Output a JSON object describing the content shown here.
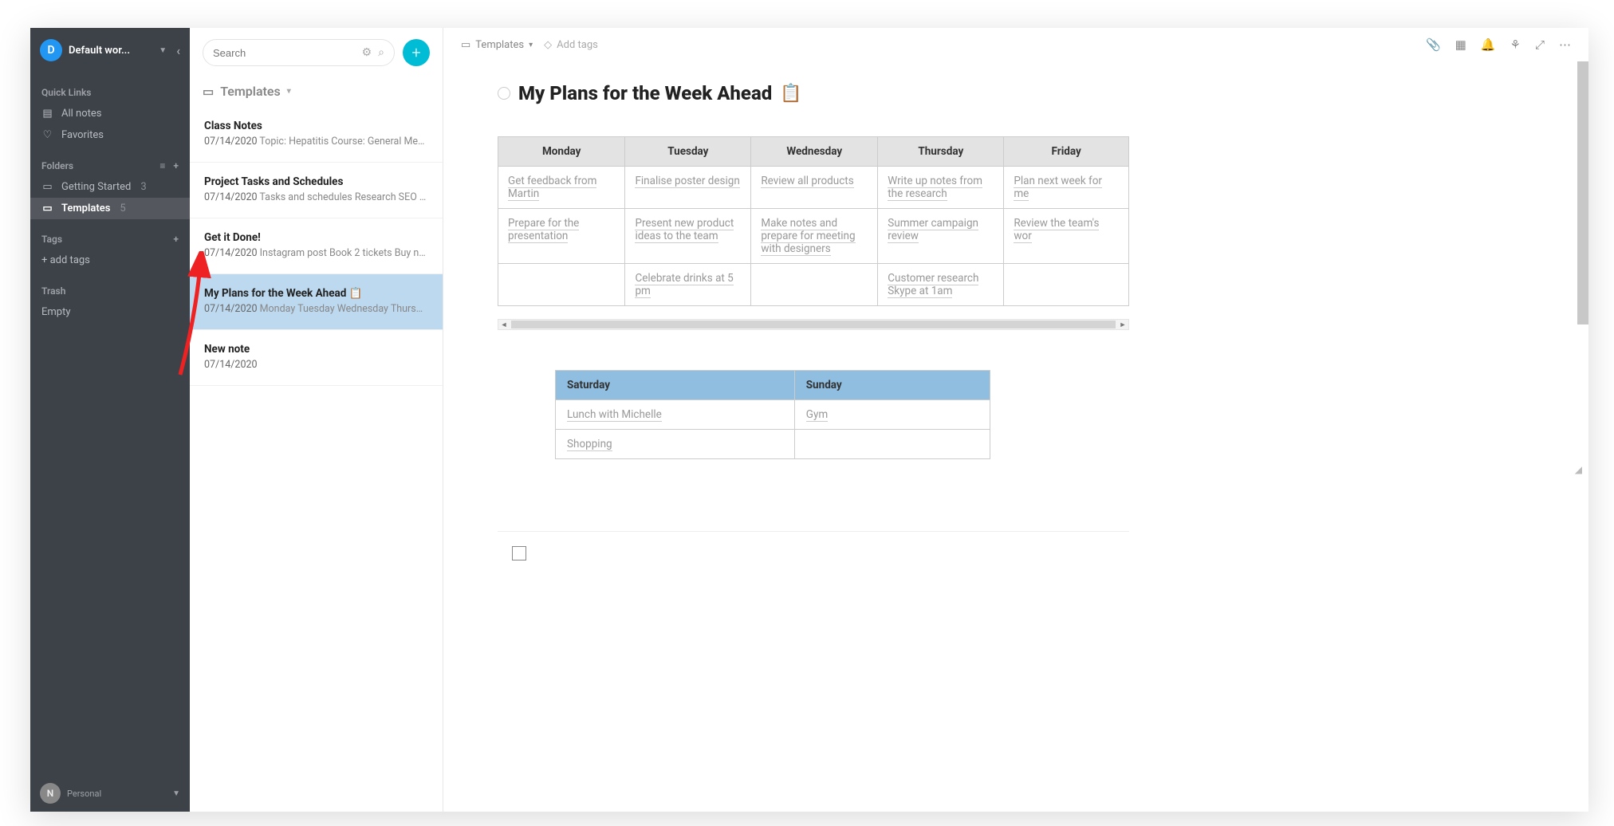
{
  "workspace": {
    "initial": "D",
    "name": "Default wor..."
  },
  "sidebar": {
    "quick_links_label": "Quick Links",
    "all_notes": "All notes",
    "favorites": "Favorites",
    "folders_label": "Folders",
    "folders": [
      {
        "name": "Getting Started",
        "count": "3"
      },
      {
        "name": "Templates",
        "count": "5"
      }
    ],
    "tags_label": "Tags",
    "add_tags": "+ add tags",
    "trash_label": "Trash",
    "empty": "Empty",
    "user": {
      "name": "",
      "plan": "Personal",
      "initial": "N"
    }
  },
  "notes_column": {
    "search_placeholder": "Search",
    "header": "Templates",
    "items": [
      {
        "title": "Class Notes",
        "date": "07/14/2020",
        "snippet": "Topic: Hepatitis Course: General Medi..."
      },
      {
        "title": "Project Tasks and Schedules",
        "date": "07/14/2020",
        "snippet": "Tasks and schedules Research SEO ke..."
      },
      {
        "title": "Get it Done!",
        "date": "07/14/2020",
        "snippet": "Instagram post Book 2 tickets Buy ne..."
      },
      {
        "title": "My Plans for the Week Ahead 📋",
        "date": "07/14/2020",
        "snippet": "Monday Tuesday Wednesday Thursda..."
      },
      {
        "title": "New note",
        "date": "07/14/2020",
        "snippet": ""
      }
    ]
  },
  "main": {
    "breadcrumb": "Templates",
    "add_tags": "Add tags",
    "title": "My Plans for the Week Ahead",
    "emoji": "📋",
    "week_table": {
      "headers": [
        "Monday",
        "Tuesday",
        "Wednesday",
        "Thursday",
        "Friday"
      ],
      "rows": [
        [
          "Get feedback from Martin",
          "Finalise poster design",
          "Review all products",
          "Write up notes from the research",
          "Plan next week for me"
        ],
        [
          "Prepare for the presentation",
          "Present new product ideas to the team",
          "Make notes and prepare for meeting with designers",
          "Summer campaign review",
          "Review the team's wor"
        ],
        [
          "",
          "Celebrate drinks at 5 pm",
          "",
          "Customer research Skype at 1am",
          ""
        ]
      ]
    },
    "weekend_table": {
      "headers": [
        "Saturday",
        "Sunday"
      ],
      "rows": [
        [
          "Lunch with Michelle",
          "Gym"
        ],
        [
          "Shopping",
          ""
        ]
      ]
    }
  }
}
